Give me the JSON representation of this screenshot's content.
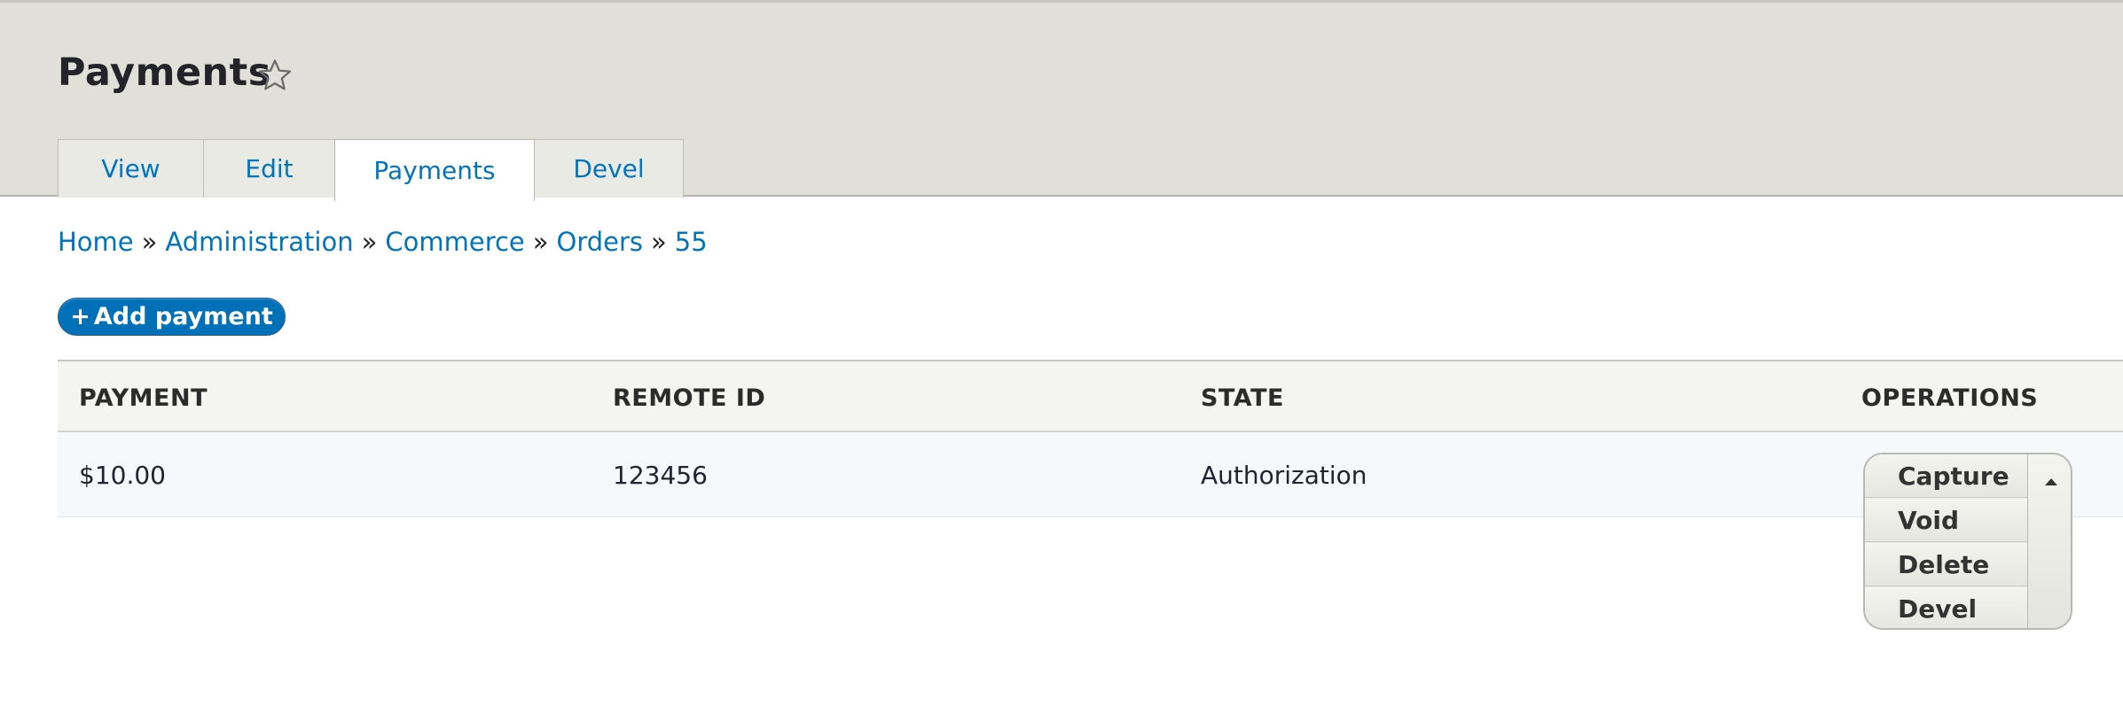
{
  "page": {
    "title": "Payments"
  },
  "tabs": [
    {
      "label": "View",
      "active": false
    },
    {
      "label": "Edit",
      "active": false
    },
    {
      "label": "Payments",
      "active": true
    },
    {
      "label": "Devel",
      "active": false
    }
  ],
  "breadcrumb": {
    "items": [
      "Home",
      "Administration",
      "Commerce",
      "Orders",
      "55"
    ],
    "separator": "»"
  },
  "actions": {
    "add_payment": "Add payment",
    "add_icon": "+"
  },
  "table": {
    "headers": [
      "Payment",
      "Remote ID",
      "State",
      "Operations"
    ],
    "rows": [
      {
        "payment": "$10.00",
        "remote_id": "123456",
        "state": "Authorization"
      }
    ]
  },
  "operations": {
    "items": [
      "Capture",
      "Void",
      "Delete",
      "Devel"
    ],
    "toggle_icon": "caret-up-icon"
  },
  "colors": {
    "link": "#0074bd",
    "primary_button": "#0071b8",
    "header_bg": "#e0e0d8"
  },
  "icons": {
    "favorite": "star-outline-icon"
  }
}
